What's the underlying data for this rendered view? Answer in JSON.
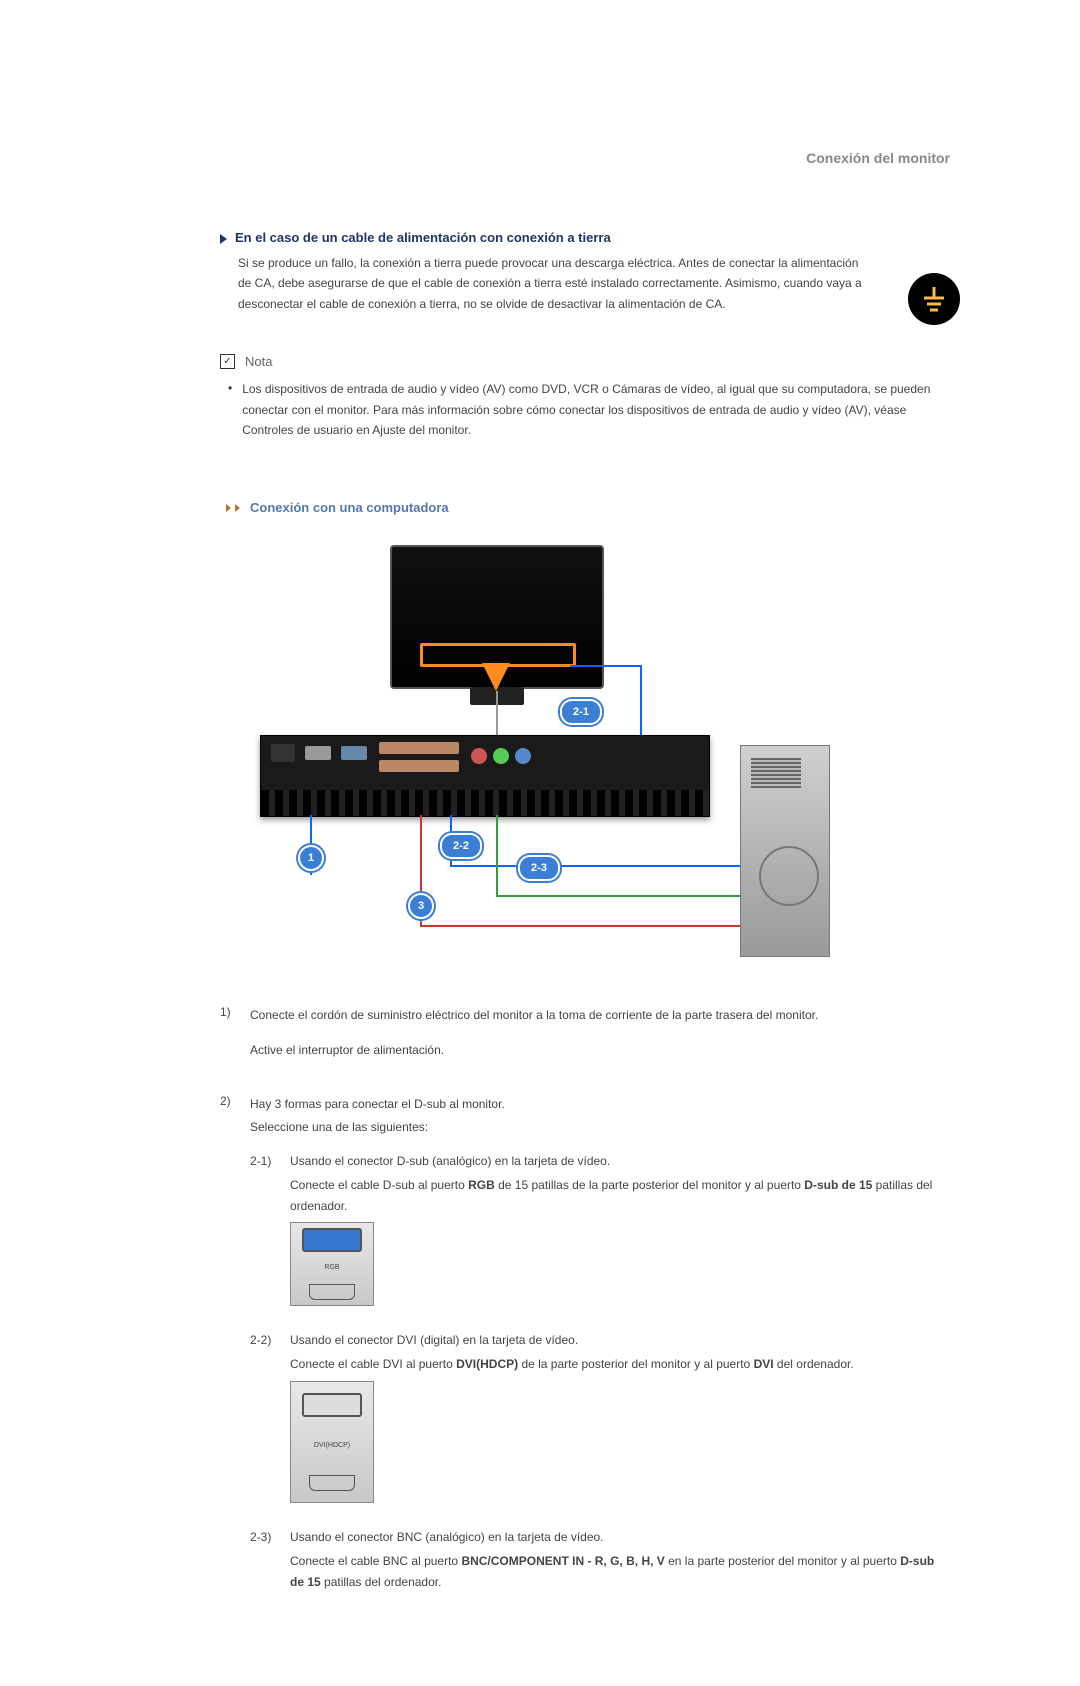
{
  "header": {
    "topRight": "Conexión del monitor"
  },
  "groundSection": {
    "heading": "En el caso de un cable de alimentación con conexión a tierra",
    "body": "Si se produce un fallo, la conexión a tierra puede provocar una descarga eléctrica. Antes de conectar la alimentación de CA, debe asegurarse de que el cable de conexión a tierra esté instalado correctamente. Asimismo, cuando vaya a desconectar el cable de conexión a tierra, no se olvide de desactivar la alimentación de CA."
  },
  "nota": {
    "label": "Nota",
    "body": "Los dispositivos de entrada de audio y vídeo (AV) como DVD, VCR o Cámaras de vídeo, al igual que su computadora, se pueden conectar con el monitor. Para más información sobre cómo conectar los dispositivos de entrada de audio y vídeo (AV), véase Controles de usuario en Ajuste del monitor."
  },
  "computerSection": {
    "heading": "Conexión con una computadora",
    "markers": {
      "m1": "1",
      "m21": "2-1",
      "m22": "2-2",
      "m23": "2-3",
      "m3": "3"
    }
  },
  "steps": {
    "s1": {
      "num": "1)",
      "p1": "Conecte el cordón de suministro eléctrico del monitor a la toma de corriente de la parte trasera del monitor.",
      "p2": "Active el interruptor de alimentación."
    },
    "s2": {
      "num": "2)",
      "intro1": "Hay 3 formas para conectar el D-sub al monitor.",
      "intro2": "Seleccione una de las siguientes:",
      "a": {
        "num": "2-1)",
        "l1": "Usando el conector D-sub (analógico) en la tarjeta de vídeo.",
        "l2a": "Conecte el cable D-sub al puerto ",
        "l2b": "RGB",
        "l2c": " de 15 patillas de la parte posterior del monitor y al puerto ",
        "l2d": "D-sub de 15",
        "l2e": " patillas del ordenador.",
        "portLabel": "RGB"
      },
      "b": {
        "num": "2-2)",
        "l1": "Usando el conector DVI (digital) en la tarjeta de vídeo.",
        "l2a": "Conecte el cable DVI al puerto ",
        "l2b": "DVI(HDCP)",
        "l2c": " de la parte posterior del monitor y al puerto ",
        "l2d": "DVI",
        "l2e": " del ordenador.",
        "portLabel": "DVI(HDCP)"
      },
      "c": {
        "num": "2-3)",
        "l1": "Usando el conector BNC (analógico) en la tarjeta de vídeo.",
        "l2a": "Conecte el cable BNC al puerto ",
        "l2b": "BNC/COMPONENT IN - R, G, B, H, V",
        "l2c": " en la parte posterior del monitor y al puerto ",
        "l2d": "D-sub de 15",
        "l2e": " patillas del ordenador."
      }
    }
  }
}
